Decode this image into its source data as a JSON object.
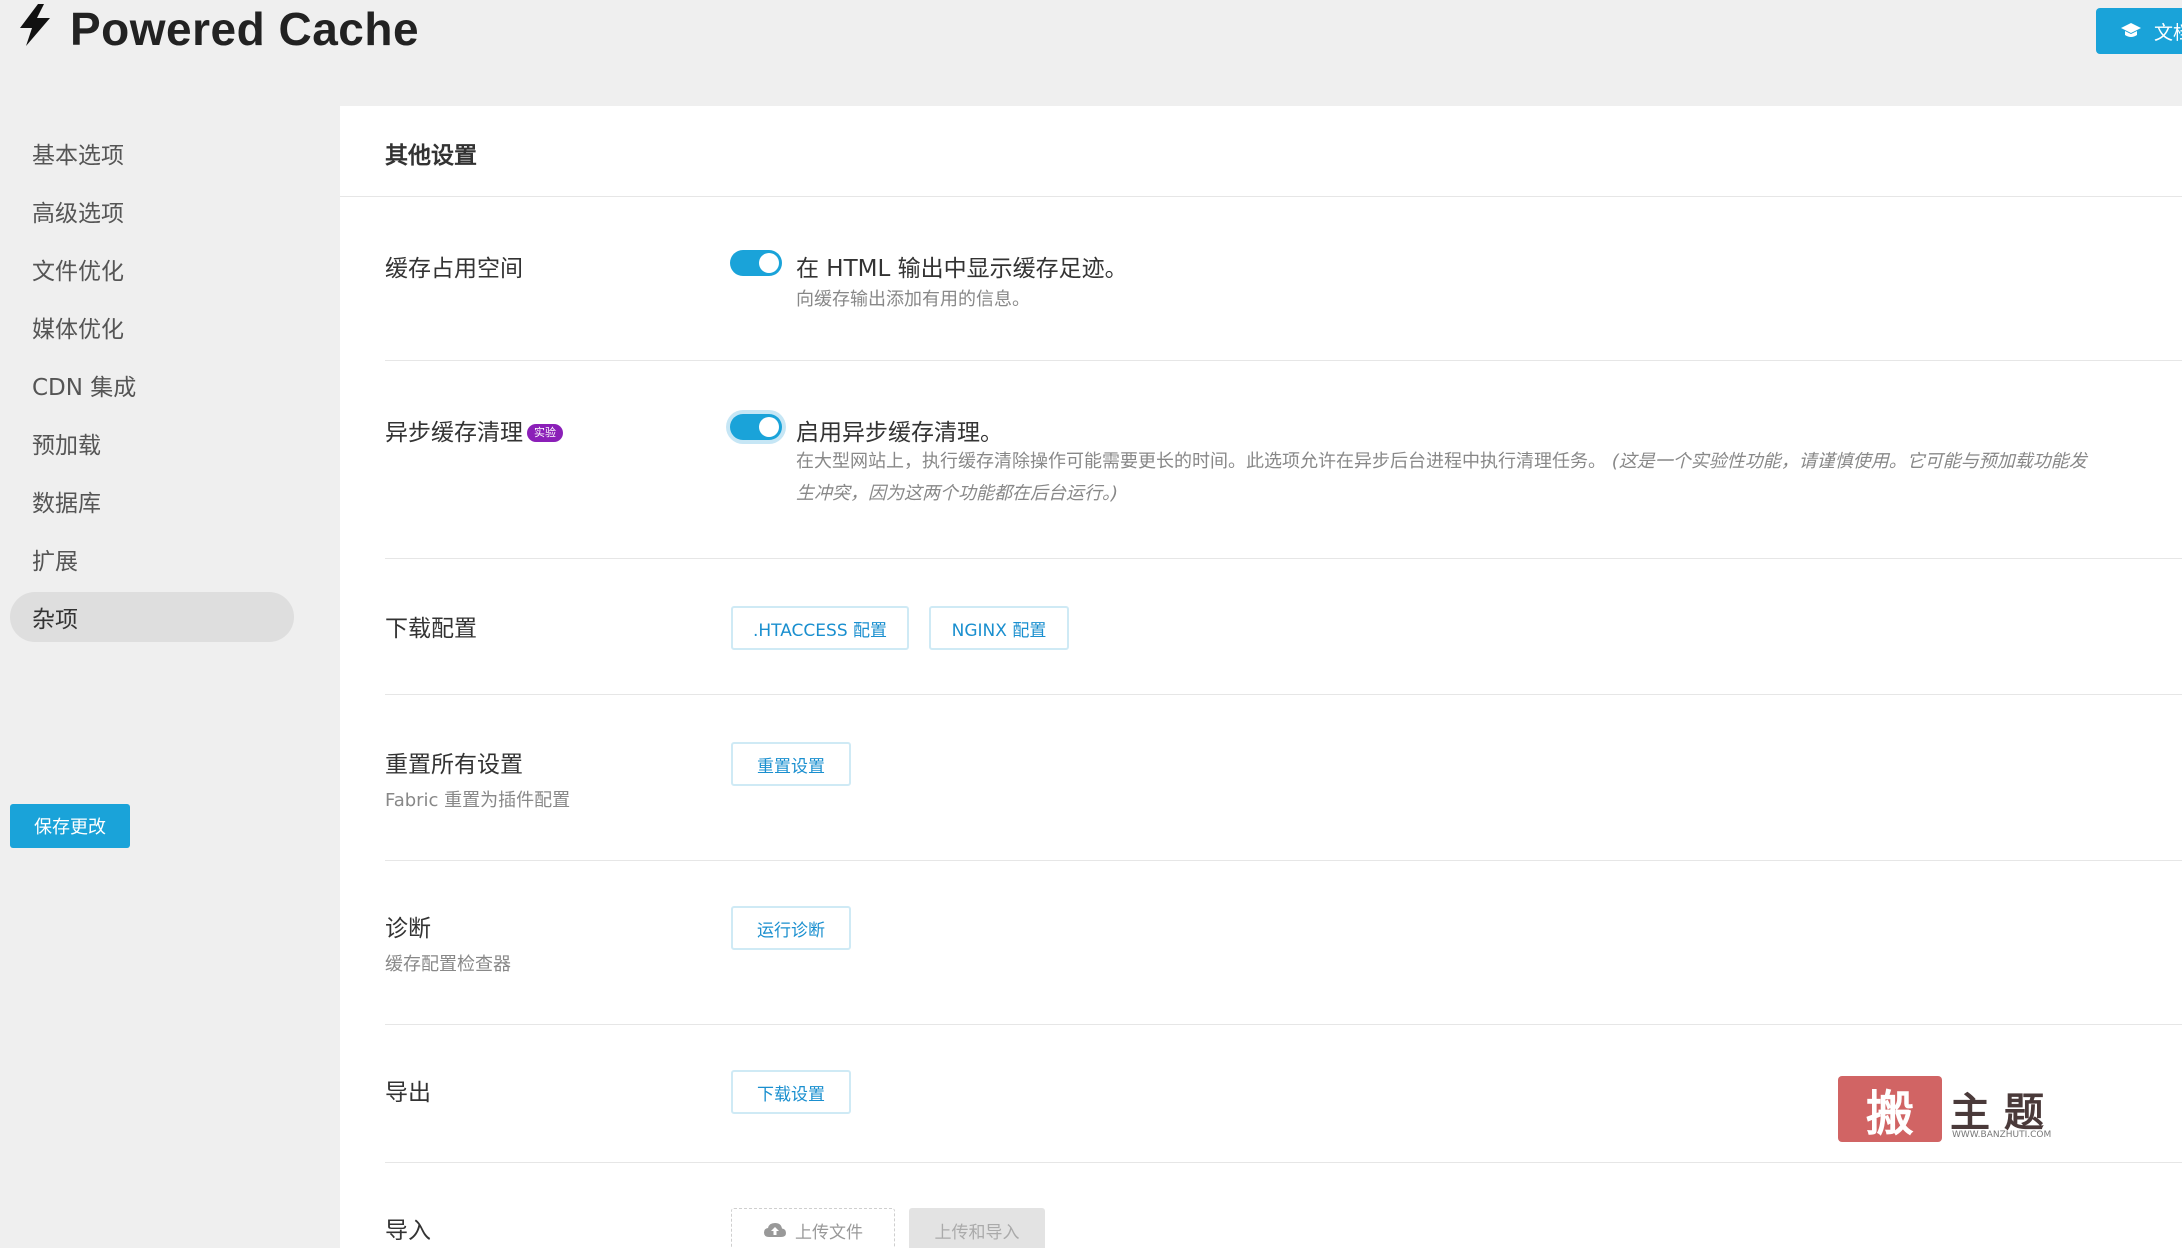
{
  "app": {
    "title": "Powered Cache",
    "docs_label": "文档"
  },
  "sidebar": {
    "items": [
      {
        "label": "基本选项"
      },
      {
        "label": "高级选项"
      },
      {
        "label": "文件优化"
      },
      {
        "label": "媒体优化"
      },
      {
        "label": "CDN 集成"
      },
      {
        "label": "预加载"
      },
      {
        "label": "数据库"
      },
      {
        "label": "扩展"
      },
      {
        "label": "杂项",
        "active": true
      }
    ],
    "save_label": "保存更改"
  },
  "panel": {
    "title": "其他设置",
    "rows": {
      "footprint": {
        "label": "缓存占用空间",
        "option_title": "在 HTML 输出中显示缓存足迹。",
        "option_desc": "向缓存输出添加有用的信息。",
        "enabled": true
      },
      "async": {
        "label": "异步缓存清理",
        "badge": "实验",
        "option_title": "启用异步缓存清理。",
        "option_desc_1": "在大型网站上，执行缓存清除操作可能需要更长的时间。此选项允许在异步后台进程中执行清理任务。",
        "option_desc_2": "(这是一个实验性功能，请谨慎使用。它可能与预加载功能发",
        "option_desc_3": "生冲突，因为这两个功能都在后台运行。)",
        "enabled": true
      },
      "download_config": {
        "label": "下载配置",
        "htaccess_label": ".HTACCESS 配置",
        "nginx_label": "NGINX 配置"
      },
      "reset": {
        "label": "重置所有设置",
        "desc": "Fabric 重置为插件配置",
        "button_label": "重置设置"
      },
      "diagnostics": {
        "label": "诊断",
        "desc": "缓存配置检查器",
        "button_label": "运行诊断"
      },
      "export": {
        "label": "导出",
        "button_label": "下载设置"
      },
      "import": {
        "label": "导入",
        "upload_label": "上传文件",
        "import_label": "上传和导入"
      }
    }
  },
  "watermark": {
    "stamp": "搬",
    "text": "主题",
    "url": "WWW.BANZHUTI.COM"
  },
  "colors": {
    "accent": "#1aa3d9",
    "badge": "#8b1fb8"
  }
}
